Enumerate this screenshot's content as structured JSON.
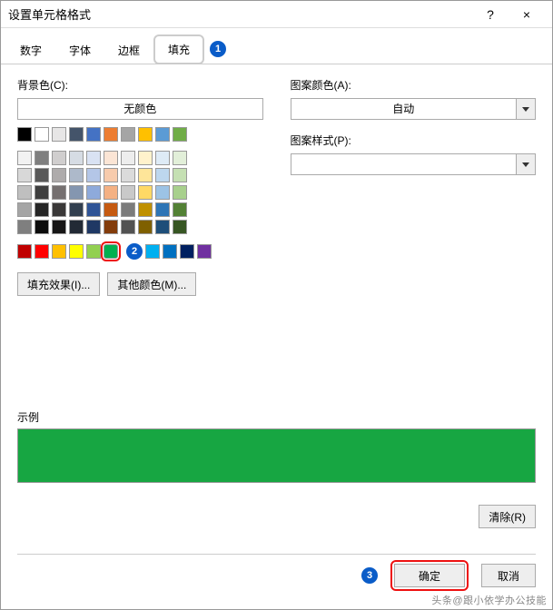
{
  "window": {
    "title": "设置单元格格式",
    "help": "?",
    "close": "×"
  },
  "tabs": {
    "items": [
      "数字",
      "字体",
      "边框",
      "填充"
    ],
    "active_index": 3
  },
  "markers": {
    "m1": "1",
    "m2": "2",
    "m3": "3"
  },
  "left": {
    "bgcolor_label": "背景色(C):",
    "nocolor": "无颜色",
    "fill_effects": "填充效果(I)...",
    "more_colors": "其他颜色(M)...",
    "row1": [
      "#000000",
      "#ffffff",
      "#e7e6e6",
      "#44546a",
      "#4472c4",
      "#ed7d31",
      "#a5a5a5",
      "#ffc000",
      "#5b9bd5",
      "#70ad47"
    ],
    "theme_rows": [
      [
        "#f2f2f2",
        "#7f7f7f",
        "#d0cece",
        "#d6dce4",
        "#d9e2f3",
        "#fbe5d5",
        "#ededed",
        "#fff2cc",
        "#deebf6",
        "#e2efd9"
      ],
      [
        "#d8d8d8",
        "#595959",
        "#aeabab",
        "#adb9ca",
        "#b4c6e7",
        "#f7cbac",
        "#dbdbdb",
        "#fee599",
        "#bdd7ee",
        "#c5e0b3"
      ],
      [
        "#bfbfbf",
        "#3f3f3f",
        "#757070",
        "#8496b0",
        "#8eaadb",
        "#f4b183",
        "#c9c9c9",
        "#ffd965",
        "#9cc3e5",
        "#a8d08d"
      ],
      [
        "#a5a5a5",
        "#262626",
        "#3a3838",
        "#323f4f",
        "#2f5496",
        "#c55a11",
        "#7b7b7b",
        "#bf9000",
        "#2e75b5",
        "#538135"
      ],
      [
        "#7f7f7f",
        "#0c0c0c",
        "#171616",
        "#222a35",
        "#1f3864",
        "#833c0b",
        "#525252",
        "#7f6000",
        "#1e4e79",
        "#375623"
      ]
    ],
    "standard": [
      "#c00000",
      "#ff0000",
      "#ffc000",
      "#ffff00",
      "#92d050",
      "#00b050",
      "#00b0f0",
      "#0070c0",
      "#002060",
      "#7030a0"
    ],
    "selected_standard_index": 5
  },
  "right": {
    "pattern_color_label": "图案颜色(A):",
    "pattern_color_value": "自动",
    "pattern_style_label": "图案样式(P):",
    "pattern_style_value": ""
  },
  "sample": {
    "label": "示例",
    "color": "#17a642"
  },
  "buttons": {
    "clear": "清除(R)",
    "ok": "确定",
    "cancel": "取消"
  },
  "watermark": "头条@跟小依学办公技能"
}
